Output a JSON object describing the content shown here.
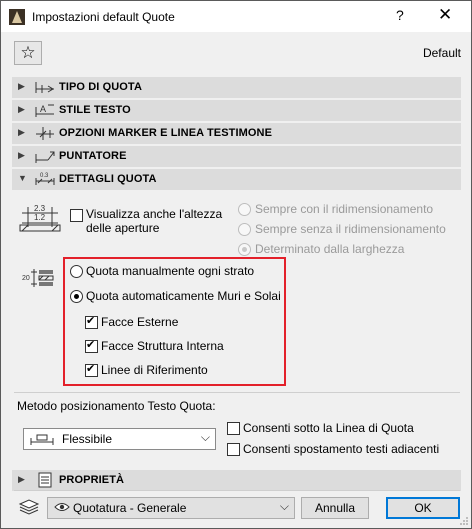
{
  "window": {
    "title": "Impostazioni default Quote",
    "help_glyph": "?",
    "close_glyph": "✕"
  },
  "toolbar": {
    "favorite_glyph": "☆",
    "default_label": "Default"
  },
  "panels": [
    {
      "label": "TIPO DI QUOTA",
      "arrow": "▶",
      "icon": "dimension-type-icon"
    },
    {
      "label": "STILE TESTO",
      "arrow": "▶",
      "icon": "text-style-icon"
    },
    {
      "label": "OPZIONI MARKER E LINEA TESTIMONE",
      "arrow": "▶",
      "icon": "marker-line-icon"
    },
    {
      "label": "PUNTATORE",
      "arrow": "▶",
      "icon": "pointer-icon"
    },
    {
      "label": "DETTAGLI QUOTA",
      "arrow": "▼",
      "icon": "dimension-details-icon"
    }
  ],
  "details": {
    "icon_text_top": "2.3",
    "icon_text_bottom": "1.2",
    "show_opening_height": {
      "label_line1": "Visualizza anche l'altezza",
      "label_line2": "delle aperture",
      "checked": false
    },
    "height_radios": [
      {
        "label": "Sempre con il ridimensionamento",
        "checked": false,
        "enabled": false
      },
      {
        "label": "Sempre senza il ridimensionamento",
        "checked": false,
        "enabled": false
      },
      {
        "label": "Determinato dalla larghezza",
        "checked": true,
        "enabled": false
      }
    ],
    "strata_icon_text": "20",
    "strata_radios": [
      {
        "label": "Quota manualmente ogni strato",
        "checked": false
      },
      {
        "label": "Quota automaticamente Muri e Solai",
        "checked": true
      }
    ],
    "strata_checkboxes": [
      {
        "label": "Facce Esterne",
        "checked": true
      },
      {
        "label": "Facce Struttura Interna",
        "checked": true
      },
      {
        "label": "Linee di Riferimento",
        "checked": true
      }
    ]
  },
  "text_position": {
    "section_label": "Metodo posizionamento Testo Quota:",
    "select_value": "Flessibile",
    "options": [
      {
        "label": "Consenti sotto la Linea di Quota",
        "checked": false
      },
      {
        "label": "Consenti spostamento testi adiacenti",
        "checked": false
      }
    ]
  },
  "properties_panel": {
    "label": "PROPRIETÀ",
    "arrow": "▶",
    "icon": "properties-icon"
  },
  "footer": {
    "layer_value": "Quotatura - Generale",
    "cancel_label": "Annulla",
    "ok_label": "OK"
  },
  "colors": {
    "highlight": "#e3202a",
    "panel_bg": "#dcdcdc",
    "primary_border": "#0078d7"
  }
}
